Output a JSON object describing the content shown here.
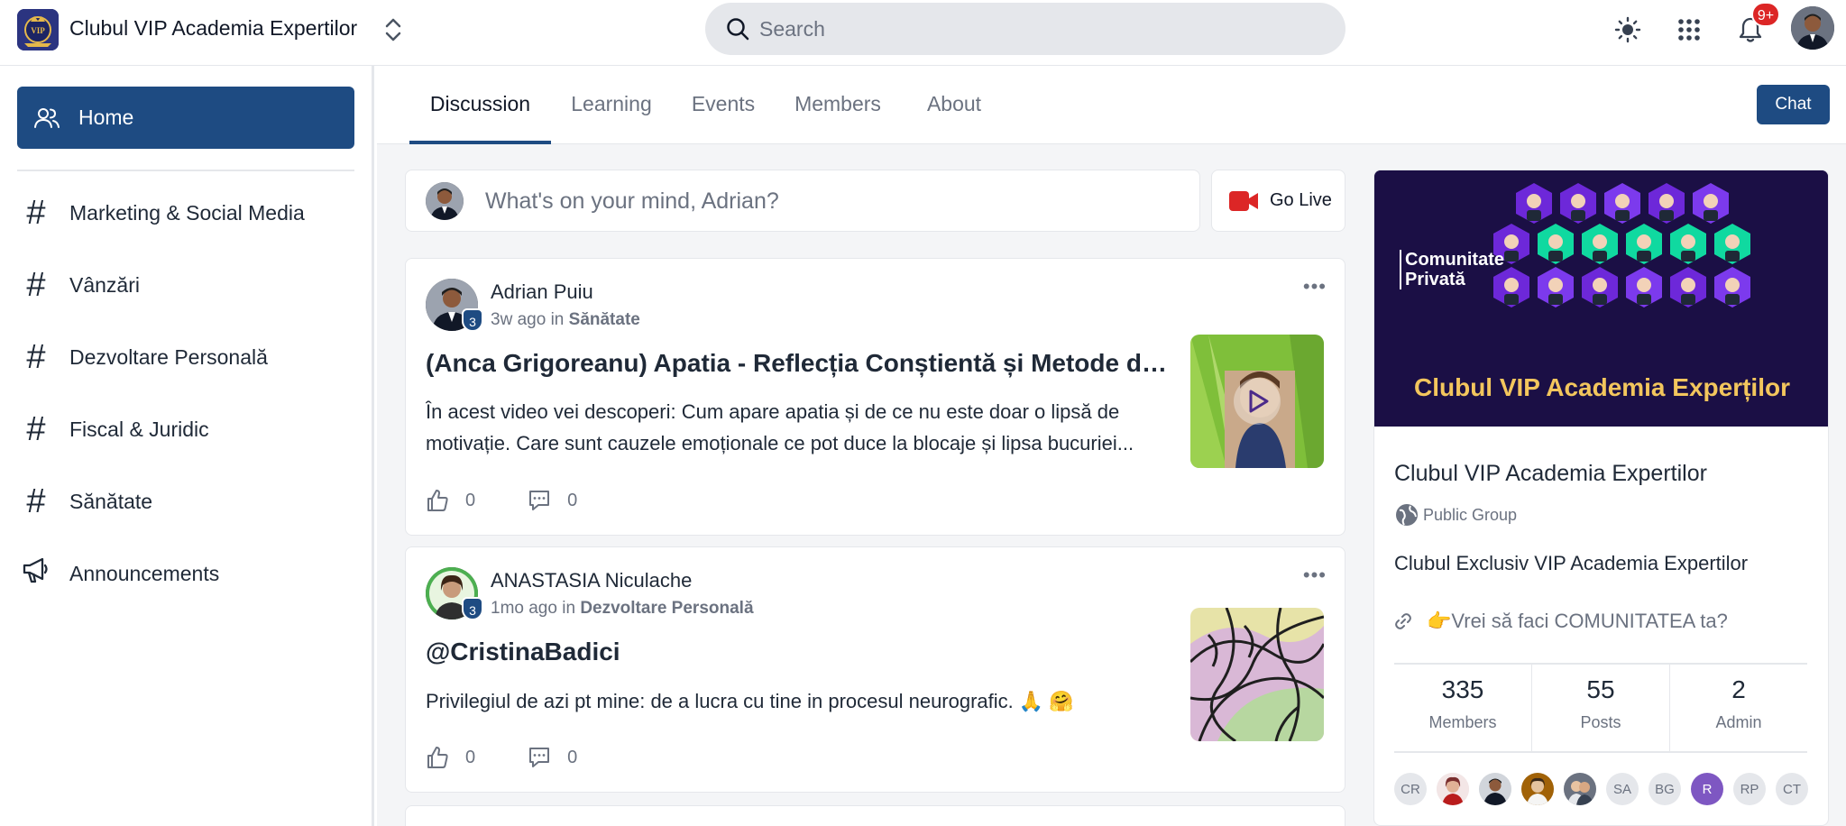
{
  "app": {
    "title": "Clubul VIP Academia Expertilor",
    "logo_text": "VIP",
    "accent_color": "#1e4b82",
    "notification_badge": "9+"
  },
  "search": {
    "placeholder": "Search",
    "icon": "search-icon"
  },
  "topbar_icons": [
    "sun-icon",
    "apps-grid-icon",
    "bell-icon"
  ],
  "sidebar": {
    "home_label": "Home",
    "items": [
      {
        "label": "Marketing & Social Media",
        "icon": "hash-icon"
      },
      {
        "label": "Vânzări",
        "icon": "hash-icon"
      },
      {
        "label": "Dezvoltare Personală",
        "icon": "hash-icon"
      },
      {
        "label": "Fiscal & Juridic",
        "icon": "hash-icon"
      },
      {
        "label": "Sănătate",
        "icon": "hash-icon"
      },
      {
        "label": "Announcements",
        "icon": "megaphone-icon"
      }
    ]
  },
  "tabs": [
    "Discussion",
    "Learning",
    "Events",
    "Members",
    "About"
  ],
  "active_tab": "Discussion",
  "chat_label": "Chat",
  "composer": {
    "placeholder": "What's on your mind, Adrian?",
    "go_live": "Go Live"
  },
  "posts": [
    {
      "author": "Adrian Puiu",
      "level": "3",
      "time": "3w ago",
      "in_word": "in",
      "category": "Sănătate",
      "title": "(Anca Grigoreanu) Apatia - Reflecția Conștientă și Metode de Eliberare",
      "body": "În acest video vei descoperi: Cum apare apatia și de ce nu este doar o lipsă de motivație. Care sunt cauzele emoționale ce pot duce la blocaje și lipsa bucuriei...",
      "likes": "0",
      "comments": "0",
      "has_video": true
    },
    {
      "author": "ANASTASIA Niculache",
      "level": "3",
      "time": "1mo ago",
      "in_word": "in",
      "category": "Dezvoltare Personală",
      "title": "@CristinaBadici",
      "body": "Privilegiul de azi pt mine: de a lucra cu tine in procesul neurografic. 🙏 🤗",
      "likes": "0",
      "comments": "0",
      "has_video": false
    }
  ],
  "group": {
    "cover_left": "Comunitate Privată",
    "cover_title": "Clubul VIP Academia Experților",
    "name": "Clubul VIP Academia Expertilor",
    "type": "Public Group",
    "description": "Clubul Exclusiv VIP Academia Expertilor",
    "link_text": "👉Vrei să faci COMUNITATEA ta?",
    "stats": [
      {
        "value": "335",
        "label": "Members"
      },
      {
        "value": "55",
        "label": "Posts"
      },
      {
        "value": "2",
        "label": "Admin"
      }
    ],
    "member_avatars": [
      "CR",
      "",
      "",
      "",
      "",
      "SA",
      "BG",
      "R",
      "RP",
      "CT"
    ]
  }
}
